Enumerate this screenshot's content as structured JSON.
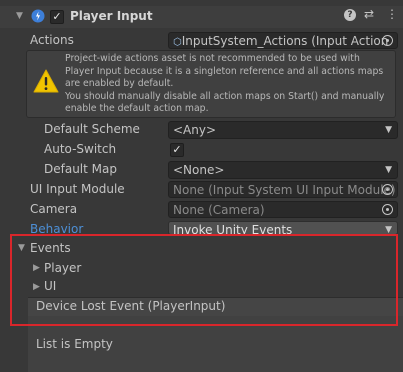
{
  "header": {
    "title": "Player Input",
    "enabled": true
  },
  "actions": {
    "label": "Actions",
    "value": "InputSystem_Actions (Input Action"
  },
  "warning": {
    "text": "Project-wide actions asset is not recommended to be used with Player Input because it is a singleton reference and all actions maps are enabled by default.\nYou should manually disable all action maps on Start() and manually enable the default action map."
  },
  "default_scheme": {
    "label": "Default Scheme",
    "value": "<Any>"
  },
  "auto_switch": {
    "label": "Auto-Switch",
    "checked": true
  },
  "default_map": {
    "label": "Default Map",
    "value": "<None>"
  },
  "ui_input_module": {
    "label": "UI Input Module",
    "value": "None (Input System UI Input Module)"
  },
  "camera": {
    "label": "Camera",
    "value": "None (Camera)"
  },
  "behavior": {
    "label": "Behavior",
    "value": "Invoke Unity Events"
  },
  "events": {
    "label": "Events",
    "items": [
      "Player",
      "UI"
    ],
    "device_lost_label": "Device Lost Event (PlayerInput)",
    "list_empty": "List is Empty"
  },
  "colors": {
    "highlight": "#d9262b",
    "behavior_label": "#4d8fd6"
  }
}
